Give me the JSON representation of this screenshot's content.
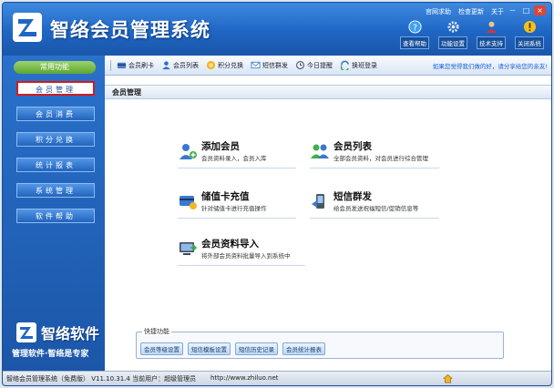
{
  "app": {
    "title": "智络会员管理系统"
  },
  "title_links": [
    "官网求助",
    "检查更新",
    "关于"
  ],
  "window_controls": [
    "－",
    "□",
    "×"
  ],
  "header_tools": [
    {
      "label": "查看帮助",
      "icon": "help-icon"
    },
    {
      "label": "功能设置",
      "icon": "settings-icon"
    },
    {
      "label": "技术支持",
      "icon": "support-person-icon"
    },
    {
      "label": "关闭系统",
      "icon": "warning-icon"
    }
  ],
  "sidebar": {
    "title": "常用功能",
    "items": [
      {
        "label": "会员管理",
        "active": true
      },
      {
        "label": "会员消费",
        "active": false
      },
      {
        "label": "积分兑换",
        "active": false
      },
      {
        "label": "统计报表",
        "active": false
      },
      {
        "label": "系统管理",
        "active": false
      },
      {
        "label": "软件帮助",
        "active": false
      }
    ],
    "brand_name": "智络软件",
    "brand_slogan": "管理软件·智络是专家"
  },
  "toolbar": {
    "items": [
      {
        "label": "会员刷卡",
        "icon": "card-swipe-icon"
      },
      {
        "label": "会员列表",
        "icon": "member-list-icon"
      },
      {
        "label": "积分兑换",
        "icon": "points-icon"
      },
      {
        "label": "短信群发",
        "icon": "sms-icon"
      },
      {
        "label": "今日提醒",
        "icon": "reminder-icon"
      },
      {
        "label": "换班登录",
        "icon": "switch-user-icon"
      }
    ],
    "notice": "如果您觉得我们做的好，请分享给您的亲友!"
  },
  "content": {
    "header": "会员管理",
    "features": [
      {
        "title": "添加会员",
        "desc": "会员资料录入，会员入库",
        "icon": "add-member-icon"
      },
      {
        "title": "会员列表",
        "desc": "全部会员资料，对会员进行综合管理",
        "icon": "member-list-icon"
      },
      {
        "title": "储值卡充值",
        "desc": "针对储值卡进行充值操作",
        "icon": "card-recharge-icon"
      },
      {
        "title": "短信群发",
        "desc": "给会员发送祝福短信/促销信息等",
        "icon": "sms-phone-icon"
      },
      {
        "title": "会员资料导入",
        "desc": "将外部会员资料批量导入到系统中",
        "icon": "import-icon"
      }
    ],
    "quick": {
      "title": "快捷功能",
      "buttons": [
        "会员等级设置",
        "短信模板设置",
        "短信历史记录",
        "会员统计报表"
      ]
    }
  },
  "status": {
    "text": "智络会员管理系统（免费版） V11.10.31.4  当前用户：超级管理员",
    "url": "http://www.zhiluo.net"
  },
  "colors": {
    "accent": "#1f66c4",
    "sidebar_active_border": "#d11c1c",
    "notice": "#1a62d6"
  }
}
